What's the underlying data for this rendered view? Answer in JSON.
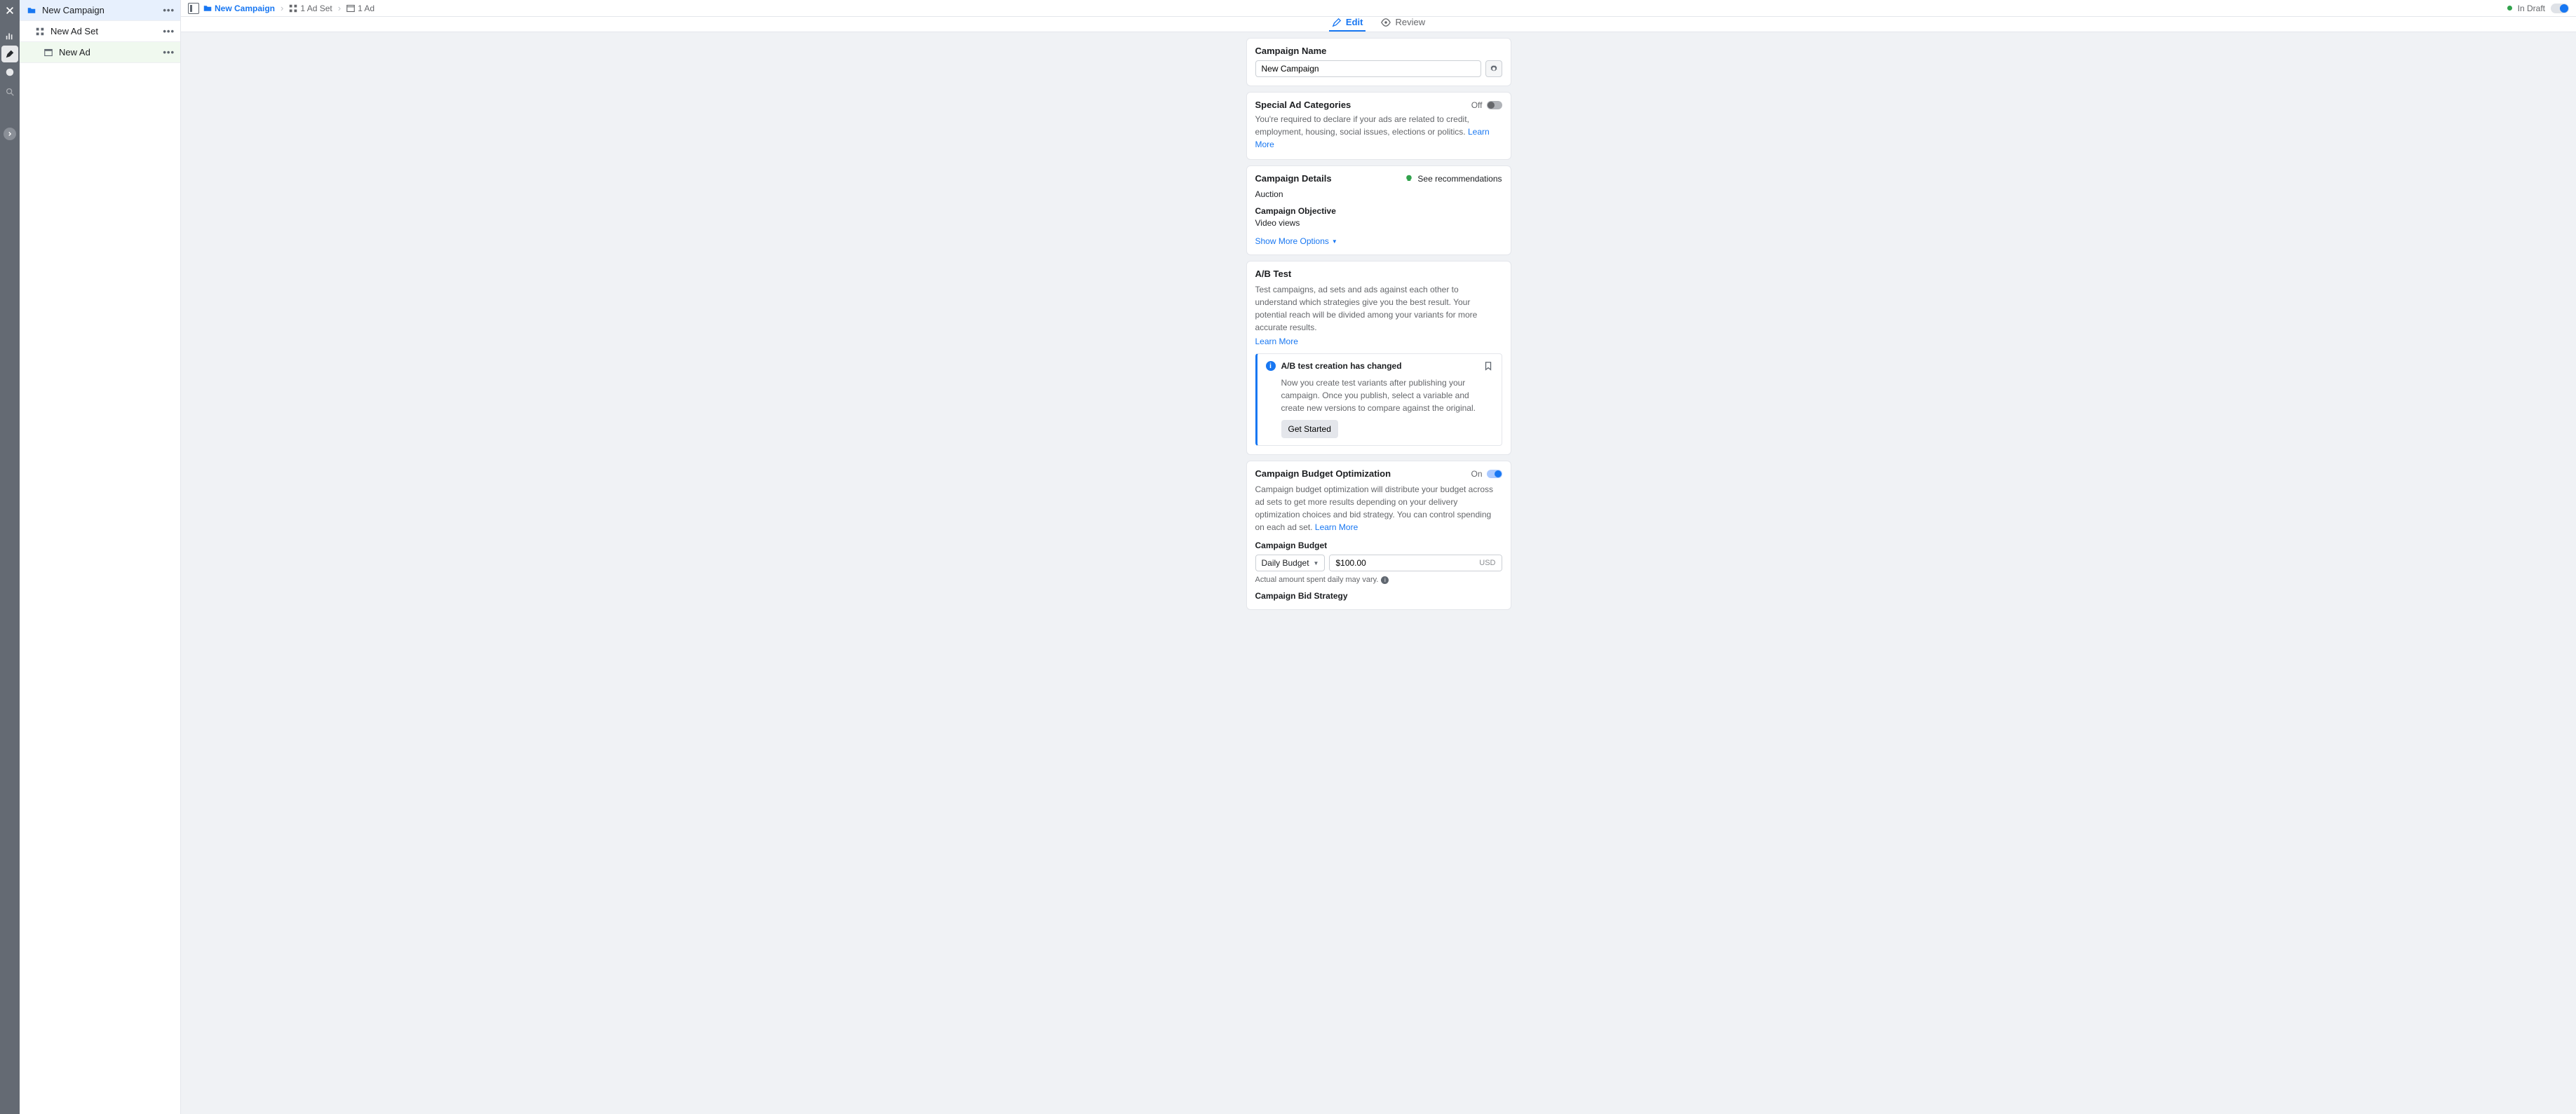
{
  "tree": {
    "campaign": "New Campaign",
    "adset": "New Ad Set",
    "ad": "New Ad"
  },
  "breadcrumb": {
    "campaign": "New Campaign",
    "adset": "1 Ad Set",
    "ad": "1 Ad"
  },
  "status": "In Draft",
  "tabs": {
    "edit": "Edit",
    "review": "Review"
  },
  "campaign_name": {
    "title": "Campaign Name",
    "value": "New Campaign"
  },
  "special_ad": {
    "title": "Special Ad Categories",
    "state": "Off",
    "desc": "You're required to declare if your ads are related to credit, employment, housing, social issues, elections or politics.",
    "learn_more": "Learn More"
  },
  "details": {
    "title": "Campaign Details",
    "recs": "See recommendations",
    "buying_type": "Auction",
    "objective_label": "Campaign Objective",
    "objective_value": "Video views",
    "show_more": "Show More Options"
  },
  "ab_test": {
    "title": "A/B Test",
    "desc": "Test campaigns, ad sets and ads against each other to understand which strategies give you the best result. Your potential reach will be divided among your variants for more accurate results.",
    "learn_more": "Learn More",
    "info_title": "A/B test creation has changed",
    "info_body": "Now you create test variants after publishing your campaign. Once you publish, select a variable and create new versions to compare against the original.",
    "get_started": "Get Started"
  },
  "cbo": {
    "title": "Campaign Budget Optimization",
    "state": "On",
    "desc": "Campaign budget optimization will distribute your budget across ad sets to get more results depending on your delivery optimization choices and bid strategy. You can control spending on each ad set.",
    "learn_more": "Learn More",
    "budget_label": "Campaign Budget",
    "budget_type": "Daily Budget",
    "amount": "$100.00",
    "currency": "USD",
    "hint": "Actual amount spent daily may vary.",
    "bid_label": "Campaign Bid Strategy"
  }
}
